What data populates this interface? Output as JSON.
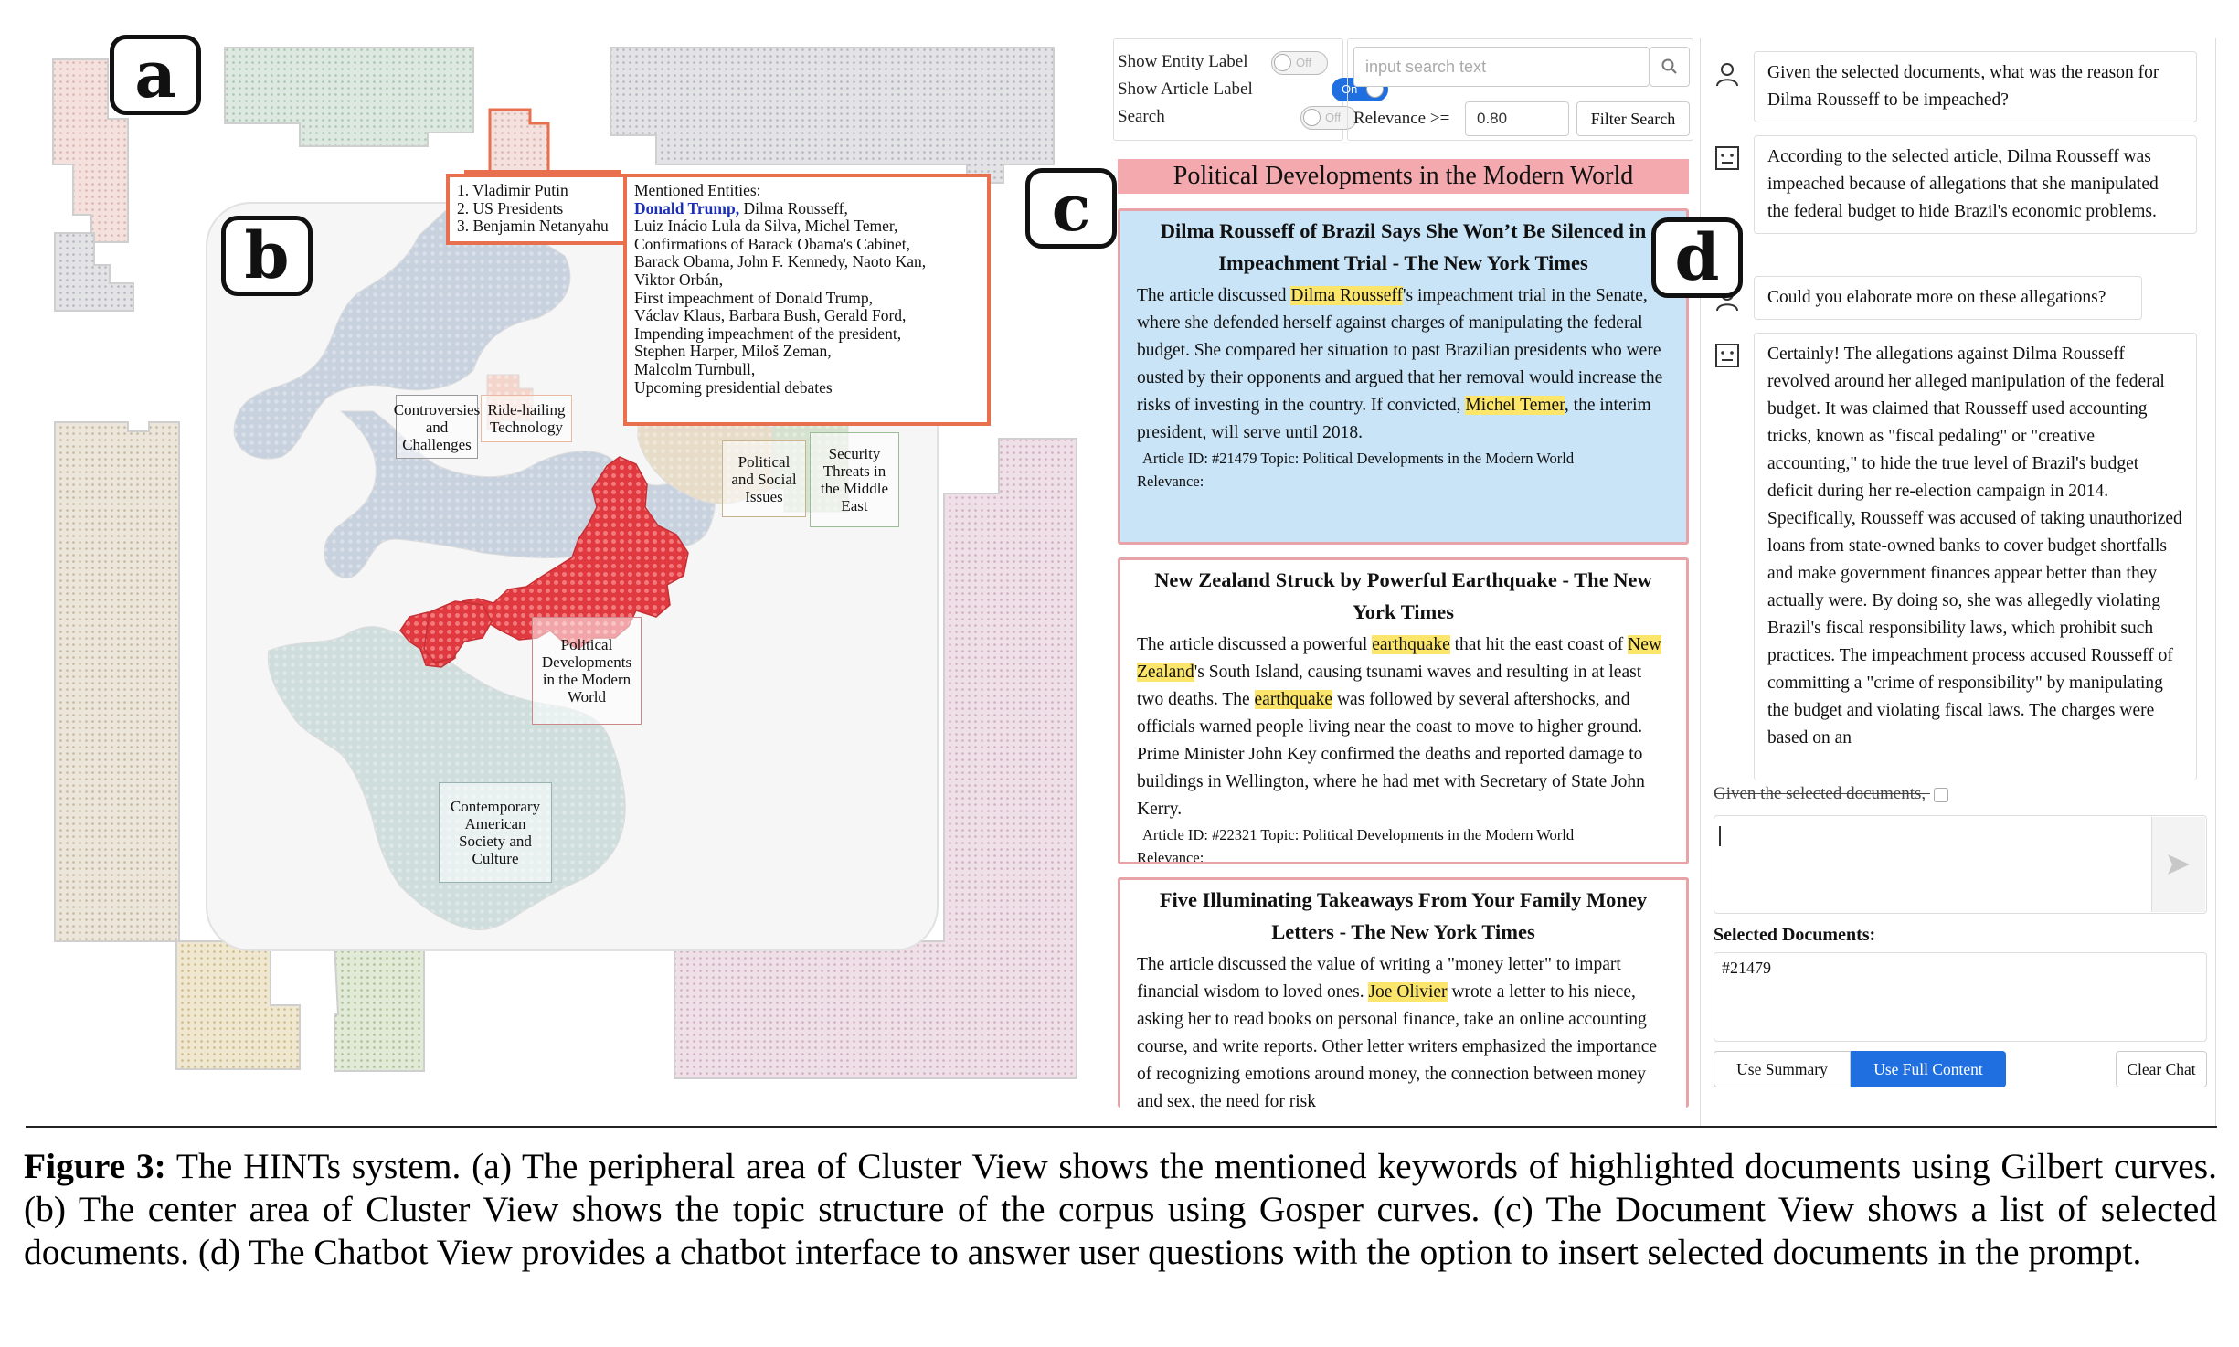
{
  "panel_letters": {
    "a": "a",
    "b": "b",
    "c": "c",
    "d": "d"
  },
  "cluster_view": {
    "topics": [
      {
        "key": "controversies",
        "label": "Controversies and Challenges"
      },
      {
        "key": "ridehailing",
        "label": "Ride-hailing Technology"
      },
      {
        "key": "political_social",
        "label": "Political and Social Issues"
      },
      {
        "key": "security",
        "label": "Security Threats in the Middle East"
      },
      {
        "key": "political_dev",
        "label": "Political Developments in the Modern World"
      },
      {
        "key": "american",
        "label": "Contemporary American Society and Culture"
      }
    ],
    "top_list": [
      "1. Vladimir Putin",
      "2. US Presidents",
      "3. Benjamin Netanyahu"
    ],
    "entities_header": "Mentioned Entities:",
    "entities_first": "Donald Trump,",
    "entities_first_rest": " Dilma Rousseff,",
    "entities_lines": [
      "Luiz Inácio Lula da Silva, Michel Temer,",
      "Confirmations of Barack Obama's Cabinet,",
      "Barack Obama, John F. Kennedy, Naoto Kan,",
      "Viktor Orbán,",
      "First impeachment of Donald Trump,",
      "Václav Klaus, Barbara Bush, Gerald Ford,",
      "Impending impeachment of the president,",
      "Stephen Harper, Miloš Zeman,",
      "Malcolm Turnbull,",
      "Upcoming presidential debates"
    ],
    "colors": {
      "highlight_red": "#e5484d",
      "callout_orange": "#e8704e"
    }
  },
  "document_view": {
    "show_entity_label": "Show Entity Label",
    "show_article_label": "Show Article Label",
    "search_label": "Search",
    "toggle_off": "Off",
    "toggle_on": "On",
    "search_placeholder": "input search text",
    "relevance_label": "Relevance >=",
    "relevance_value": "0.80",
    "filter_button": "Filter Search",
    "topic_header": "Political Developments in the Modern World",
    "cards": [
      {
        "title": "Dilma Rousseff of Brazil Says She Won’t Be Silenced in Impeachment Trial - The New York Times",
        "body_parts": [
          "The article discussed ",
          "Dilma Rousseff",
          "'s impeachment trial in the Senate, where she defended herself against charges of manipulating the federal budget. She compared her situation to past Brazilian presidents who were ousted by their opponents and argued that her removal would increase the risks of investing in the country. If convicted, ",
          "Michel Temer",
          ", the interim president, will serve until 2018."
        ],
        "meta": "Article ID: #21479   Topic: Political Developments in the Modern World",
        "relevance": "Relevance:"
      },
      {
        "title": "New Zealand Struck by Powerful Earthquake - The New York Times",
        "body_parts": [
          "The article discussed a powerful ",
          "earthquake",
          " that hit the east coast of ",
          "New Zealand",
          "'s South Island, causing tsunami waves and resulting in at least two deaths. The ",
          "earthquake",
          " was followed by several aftershocks, and officials warned people living near the coast to move to higher ground. Prime Minister John Key confirmed the deaths and reported damage to buildings in Wellington, where he had met with Secretary of State John Kerry."
        ],
        "meta": "Article ID: #22321   Topic: Political Developments in the Modern World",
        "relevance": "Relevance:"
      },
      {
        "title": "Five Illuminating Takeaways From Your Family Money Letters - The New York Times",
        "body_parts": [
          "The article discussed the value of writing a \"money letter\" to impart financial wisdom to loved ones. ",
          "Joe Olivier",
          " wrote a letter to his niece, asking her to read books on personal finance, take an online accounting course, and write reports. Other letter writers emphasized the importance of recognizing emotions around money, the connection between money and sex, the need for risk"
        ],
        "meta": "",
        "relevance": ""
      }
    ]
  },
  "chatbot_view": {
    "messages": [
      {
        "role": "user",
        "text": "Given the selected documents, what was the reason for Dilma Rousseff to be impeached?"
      },
      {
        "role": "bot",
        "text": "According to the selected article, Dilma Rousseff was impeached because of allegations that she manipulated the federal budget to hide Brazil's economic problems."
      },
      {
        "role": "user",
        "text": "Could you elaborate more on these allegations?"
      },
      {
        "role": "bot",
        "text": "Certainly! The allegations against Dilma Rousseff revolved around her alleged manipulation of the federal budget. It was claimed that Rousseff used accounting tricks, known as \"fiscal pedaling\" or \"creative accounting,\" to hide the true level of Brazil's budget deficit during her re-election campaign in 2014. Specifically, Rousseff was accused of taking unauthorized loans from state-owned banks to cover budget shortfalls and make government finances appear better than they actually were. By doing so, she was allegedly violating Brazil's fiscal responsibility laws, which prohibit such practices. The impeachment process accused Rousseff of committing a \"crime of responsibility\" by manipulating the budget and violating fiscal laws. The charges were based on an"
      }
    ],
    "prompt_prefix": "Given the selected documents,",
    "input_value": "",
    "selected_docs_label": "Selected Documents:",
    "selected_docs_value": "#21479",
    "use_summary": "Use Summary",
    "use_full_content": "Use Full Content",
    "clear_chat": "Clear Chat"
  },
  "caption": {
    "label": "Figure 3:",
    "text": " The HINTs system. (a) The peripheral area of Cluster View shows the mentioned keywords of highlighted documents using Gilbert curves. (b) The center area of Cluster View shows the topic structure of the corpus using Gosper curves. (c) The Document View shows a list of selected documents. (d) The Chatbot View provides a chatbot interface to answer user questions with the option to insert selected documents in the prompt."
  }
}
